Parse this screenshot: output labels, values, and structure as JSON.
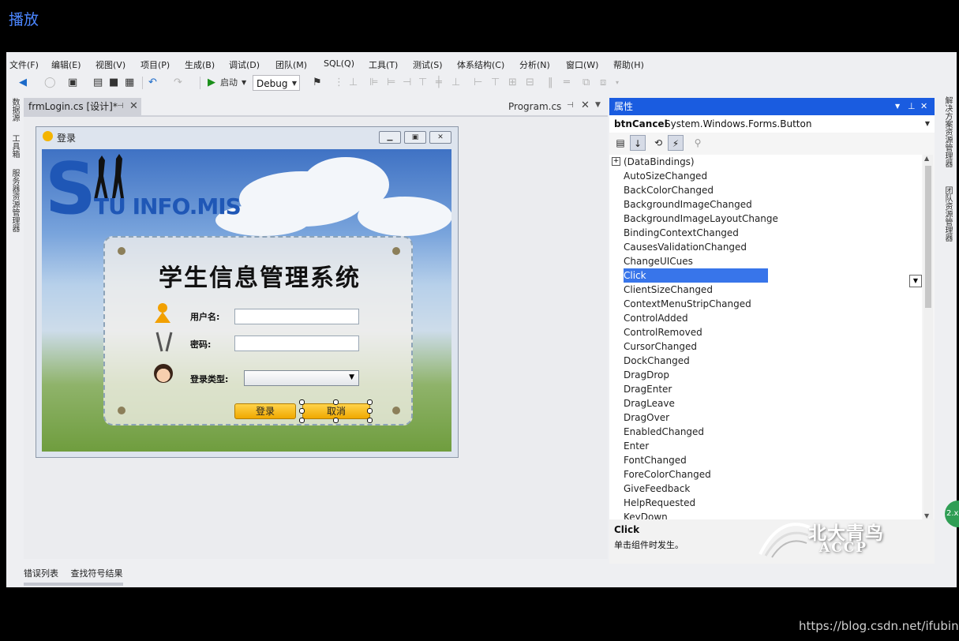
{
  "player": {
    "label": "播放"
  },
  "menu": [
    "文件(F)",
    "编辑(E)",
    "视图(V)",
    "项目(P)",
    "生成(B)",
    "调试(D)",
    "团队(M)",
    "SQL(Q)",
    "工具(T)",
    "测试(S)",
    "体系结构(C)",
    "分析(N)",
    "窗口(W)",
    "帮助(H)"
  ],
  "toolbar": {
    "start_label": "启动",
    "config_value": "Debug"
  },
  "left_strip": [
    "数据源",
    "工具箱",
    "服务器资源管理器"
  ],
  "right_strip": [
    "解决方案资源管理器",
    "团队资源管理器"
  ],
  "doc_tabs": {
    "active": "frmLogin.cs [设计]*",
    "other": "Program.cs"
  },
  "login_form": {
    "title": "登录",
    "logo_letter": "S",
    "logo_text": "TU INFO.MIS",
    "heading": "学生信息管理系统",
    "username_label": "用户名:",
    "password_label": "密码:",
    "login_type_label": "登录类型:",
    "login_button": "登录",
    "cancel_button": "取消"
  },
  "bottom_tabs": [
    "错误列表",
    "查找符号结果"
  ],
  "properties": {
    "title": "属性",
    "object_name": "btnCancel",
    "object_type": "System.Windows.Forms.Button",
    "events": [
      "(DataBindings)",
      "AutoSizeChanged",
      "BackColorChanged",
      "BackgroundImageChanged",
      "BackgroundImageLayoutChange",
      "BindingContextChanged",
      "CausesValidationChanged",
      "ChangeUICues",
      "Click",
      "ClientSizeChanged",
      "ContextMenuStripChanged",
      "ControlAdded",
      "ControlRemoved",
      "CursorChanged",
      "DockChanged",
      "DragDrop",
      "DragEnter",
      "DragLeave",
      "DragOver",
      "EnabledChanged",
      "Enter",
      "FontChanged",
      "ForeColorChanged",
      "GiveFeedback",
      "HelpRequested",
      "KeyDown"
    ],
    "selected_event": "Click",
    "description_title": "Click",
    "description_text": "单击组件时发生。"
  },
  "watermark": {
    "line1": "北大青鸟",
    "line2": "ACCP"
  },
  "overlay_badge": "2.x",
  "source_url": "https://blog.csdn.net/ifubing",
  "colors": {
    "selection": "#3875ea",
    "panel_header": "#1a5ce0",
    "button_orange": "#f0a800"
  }
}
